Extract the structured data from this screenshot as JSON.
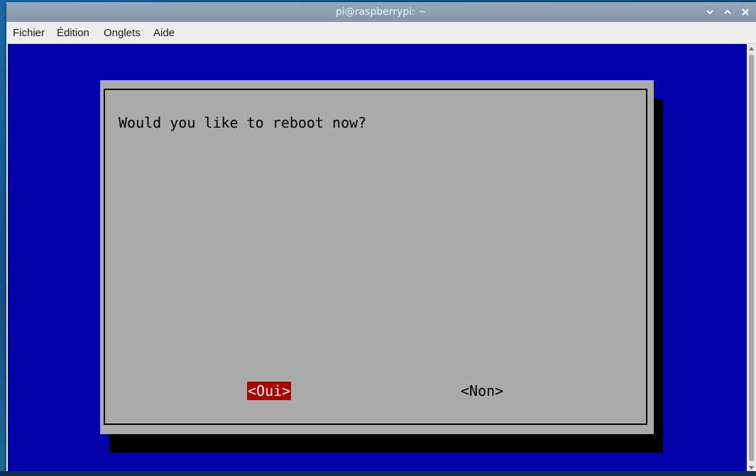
{
  "window": {
    "title": "pi@raspberrypi: ~"
  },
  "menubar": {
    "items": [
      "Fichier",
      "Édition",
      "Onglets",
      "Aide"
    ]
  },
  "terminal": {
    "background_color": "#0000aa",
    "dialog": {
      "prompt": "Would you like to reboot now?",
      "yes_label": "<Oui>",
      "no_label": "<Non>",
      "dialog_color": "#aaaaaa",
      "selected_color": "#aa0000"
    }
  },
  "icons": {
    "minimize": "chevron-down-icon",
    "maximize": "chevron-up-icon",
    "close": "close-icon"
  }
}
